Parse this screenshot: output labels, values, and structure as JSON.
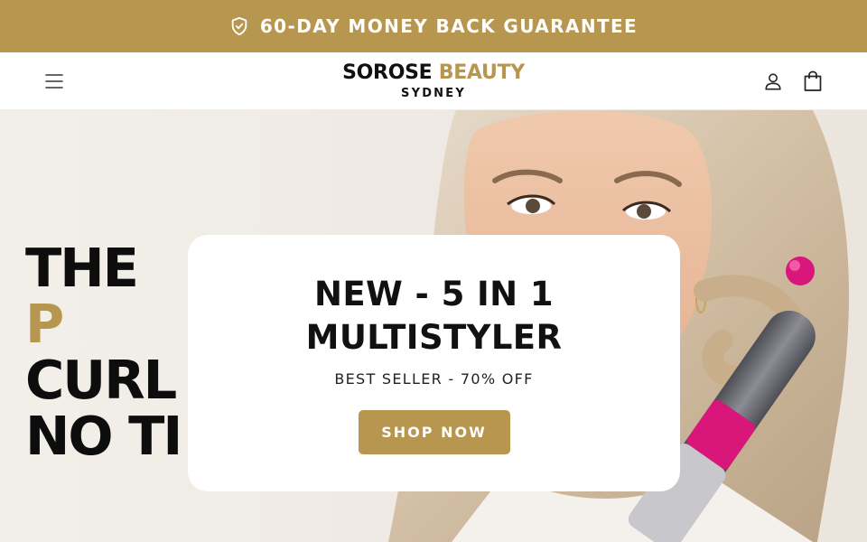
{
  "announcement": {
    "text": "60-DAY MONEY BACK GUARANTEE",
    "icon": "shield-check-icon",
    "color": "#b7974f"
  },
  "header": {
    "logo_main": "SOROSE",
    "logo_accent": "BEAUTY",
    "logo_sub": "SYDNEY",
    "icons": [
      "hamburger-menu-icon",
      "account-icon",
      "shopping-bag-icon"
    ]
  },
  "hero": {
    "headline_line1_a": "THE ",
    "headline_line1_b": "P",
    "headline_line2": "CURL",
    "headline_line3": "NO TI",
    "accent_color": "#b7974f"
  },
  "promo": {
    "title_line1": "NEW - 5 IN 1",
    "title_line2": "MULTISTYLER",
    "subtitle": "BEST SELLER - 70% OFF",
    "button_label": "SHOP NOW"
  }
}
